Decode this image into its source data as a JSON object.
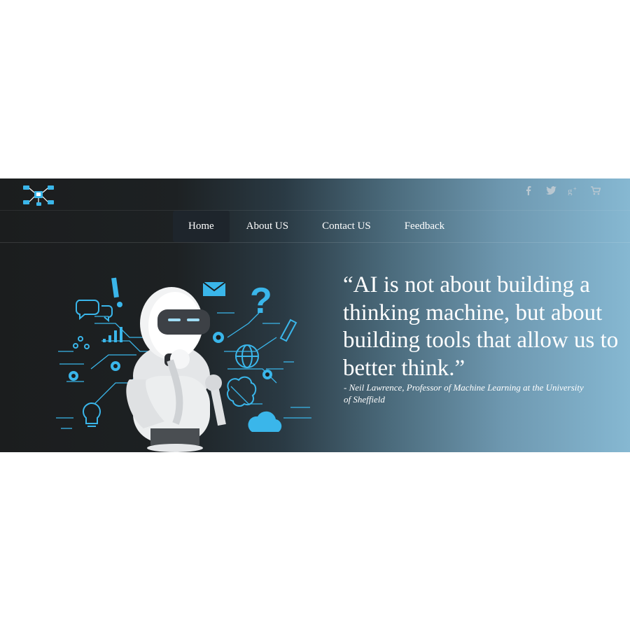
{
  "header": {
    "logo_icon": "network-logo-icon",
    "social": [
      {
        "name": "facebook-icon",
        "glyph": "f"
      },
      {
        "name": "twitter-icon",
        "glyph": "bird"
      },
      {
        "name": "google-plus-icon",
        "glyph": "g+"
      },
      {
        "name": "cart-icon",
        "glyph": "cart"
      }
    ]
  },
  "nav": {
    "items": [
      {
        "label": "Home",
        "active": true
      },
      {
        "label": "About US",
        "active": false
      },
      {
        "label": "Contact US",
        "active": false
      },
      {
        "label": "Feedback",
        "active": false
      }
    ]
  },
  "hero": {
    "illustration_icon": "robot-thinking-illustration",
    "quote": "“AI is not about building a thinking machine, but about building tools that allow us to better think.”",
    "author": "- Neil Lawrence, Professor of Machine Learning at the University of Sheffield"
  },
  "colors": {
    "accent_blue": "#3ab6ea",
    "nav_active_bg": "#1e252c",
    "gradient_start": "#1b1d1e",
    "gradient_end": "#86b8d2"
  }
}
